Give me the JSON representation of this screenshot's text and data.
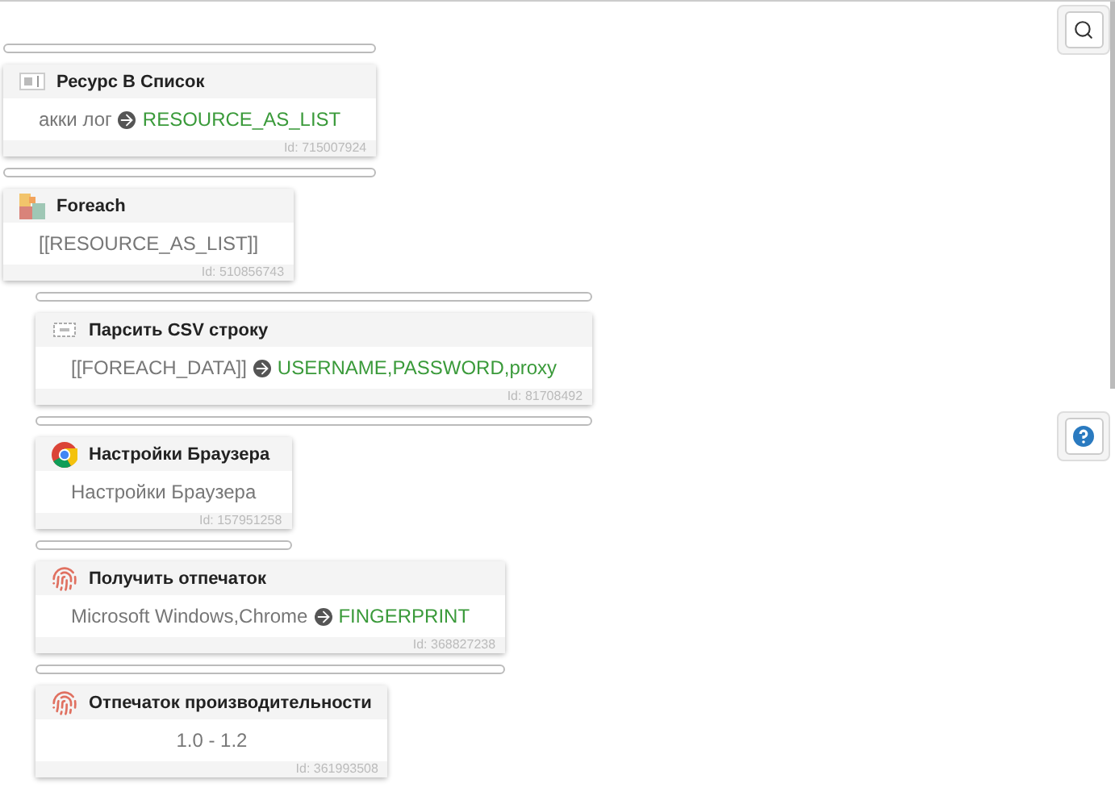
{
  "blocks": [
    {
      "kind": "text",
      "title": "Ресурс В Список",
      "input": "акки лог",
      "output": "RESOURCE_AS_LIST",
      "id": "Id: 715007924"
    },
    {
      "kind": "loop",
      "title": "Foreach",
      "input": "[[RESOURCE_AS_LIST]]",
      "id": "Id: 510856743",
      "children": [
        {
          "kind": "csv",
          "title": "Парсить CSV строку",
          "input": "[[FOREACH_DATA]]",
          "output": "USERNAME,PASSWORD,proxy",
          "id": "Id: 81708492"
        },
        {
          "kind": "browser",
          "title": "Настройки Браузера",
          "input": "Настройки Браузера",
          "id": "Id: 157951258"
        },
        {
          "kind": "fingerprint",
          "title": "Получить отпечаток",
          "input": "Microsoft Windows,Chrome",
          "output": "FINGERPRINT",
          "id": "Id: 368827238"
        },
        {
          "kind": "fingerprint",
          "title": "Отпечаток производительности",
          "input": "1.0 - 1.2",
          "id": "Id: 361993508"
        }
      ]
    }
  ]
}
